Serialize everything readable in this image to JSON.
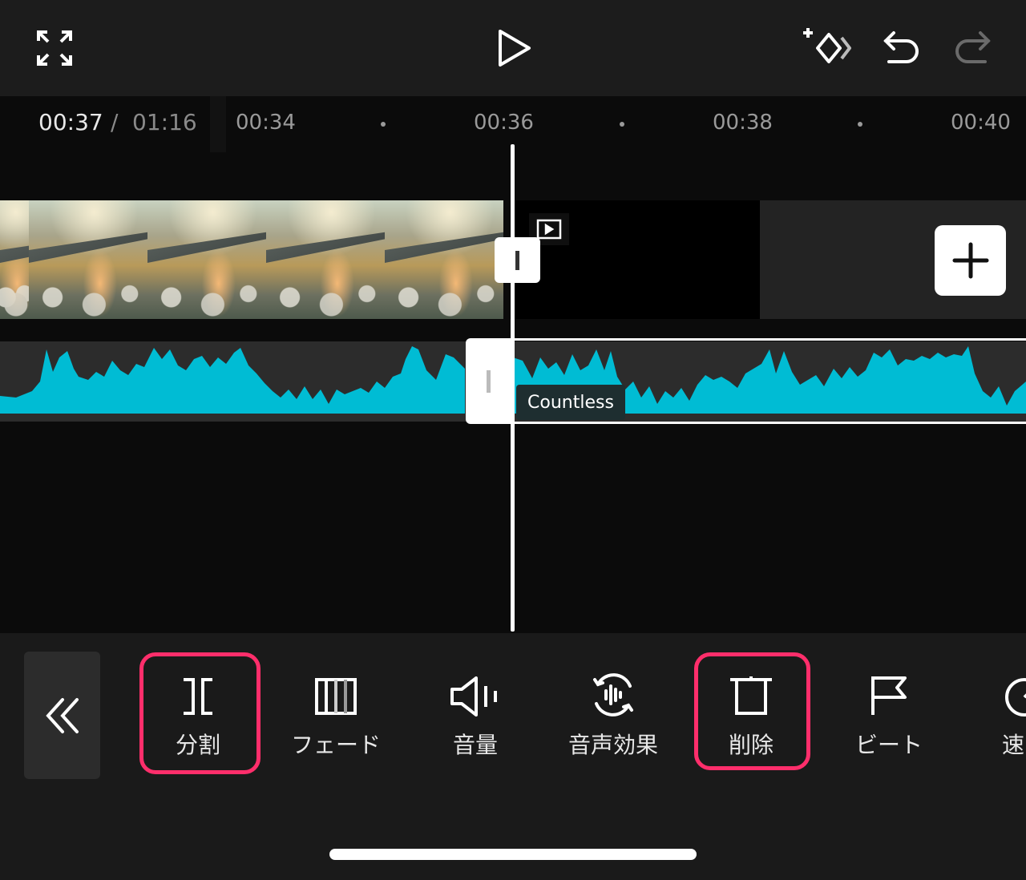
{
  "playback": {
    "current_time": "00:37",
    "separator": "/",
    "total_time": "01:16"
  },
  "ruler": {
    "ticks": [
      "00:34",
      "00:36",
      "00:38",
      "00:40"
    ]
  },
  "top_icons": [
    "fullscreen-icon",
    "play-icon",
    "keyframe-icon",
    "undo-icon",
    "redo-icon"
  ],
  "audio": {
    "label": "Countless"
  },
  "toolbar": {
    "items": [
      {
        "label": "分割",
        "icon": "split-icon",
        "highlighted": true
      },
      {
        "label": "フェード",
        "icon": "fade-icon",
        "highlighted": false
      },
      {
        "label": "音量",
        "icon": "volume-icon",
        "highlighted": false
      },
      {
        "label": "音声効果",
        "icon": "voice-effect-icon",
        "highlighted": false
      },
      {
        "label": "削除",
        "icon": "delete-icon",
        "highlighted": true
      },
      {
        "label": "ビート",
        "icon": "beat-icon",
        "highlighted": false
      },
      {
        "label": "速",
        "icon": "speed-icon",
        "highlighted": false
      }
    ]
  },
  "colors": {
    "accent_highlight": "#ff2e6b",
    "waveform": "#00bcd4",
    "background": "#0b0b0b",
    "toolbar": "#1a1a1a"
  }
}
